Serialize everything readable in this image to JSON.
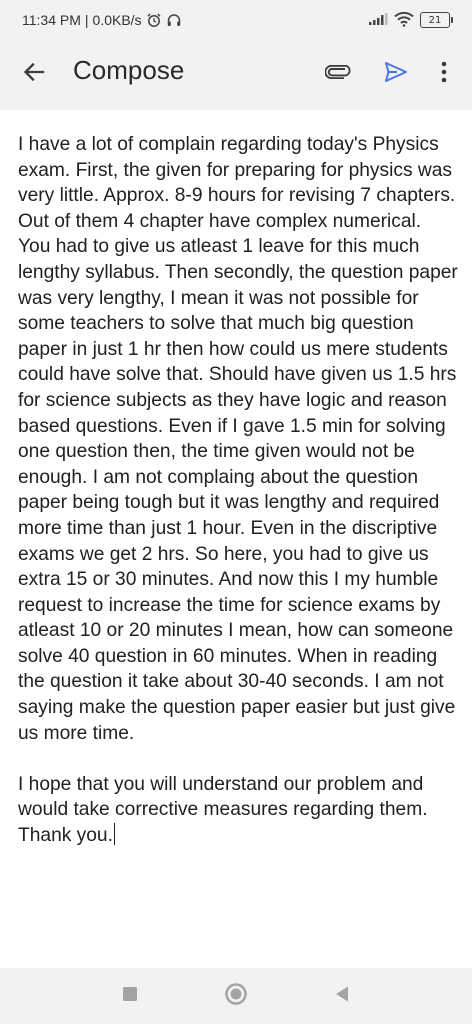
{
  "status_bar": {
    "time": "11:34 PM",
    "separator": "|",
    "network_speed": "0.0KB/s",
    "battery_level": "21",
    "icons": [
      "alarm-icon",
      "headphones-icon",
      "signal-icon",
      "wifi-icon",
      "battery-icon"
    ]
  },
  "app_bar": {
    "title": "Compose",
    "icons": [
      "back-arrow-icon",
      "paperclip-icon",
      "send-icon",
      "more-vert-icon"
    ],
    "accent_color": "#4b76e8"
  },
  "compose": {
    "body_paragraph_1": "I have a lot of complain regarding today's Physics exam. First, the given for preparing for physics was very little. Approx. 8-9 hours for revising 7 chapters. Out of them 4 chapter have complex numerical. You had to give us atleast 1 leave for this much lengthy syllabus. Then secondly, the question paper was very lengthy, I mean it was not possible for some teachers to solve that much big question paper in just 1 hr then how could us mere students could have solve that. Should have given us 1.5 hrs for science subjects as they have logic and reason based questions. Even if I gave 1.5 min for solving one question then, the time given would not be enough. I am not complaing about the question paper being tough but it was lengthy and required more time than just 1 hour. Even in the discriptive exams we get 2 hrs. So here, you had to give us extra 15 or 30 minutes. And now this I my humble request to increase the time for science exams by atleast 10 or 20 minutes I mean, how can someone solve 40 question in 60 minutes. When in reading the question it take about 30-40 seconds. I am not saying make the question paper easier but just give us more time.",
    "body_paragraph_2": "I hope that you will understand our problem and would take corrective measures regarding them. Thank you."
  },
  "nav_bar": {
    "icons": [
      "recents-square-icon",
      "home-circle-icon",
      "back-triangle-icon"
    ]
  }
}
